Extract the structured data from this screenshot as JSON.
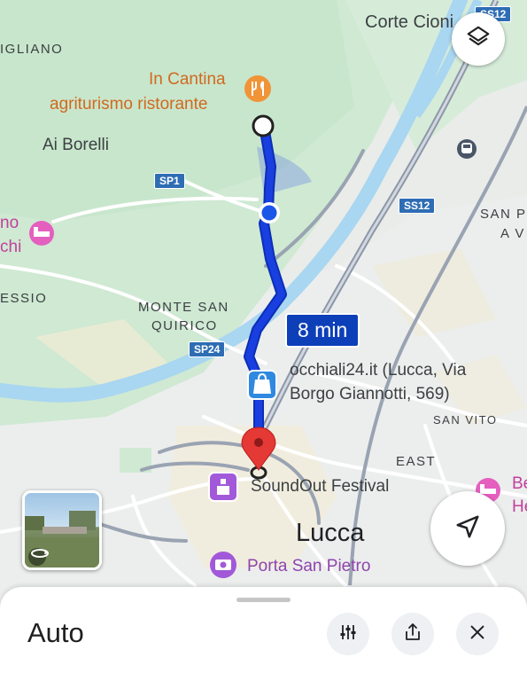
{
  "map": {
    "places": {
      "corte_cioni": "Corte Cioni",
      "migliano": "IGLIANO",
      "ai_borelli": "Ai Borelli",
      "monte_san_quirico_1": "MONTE SAN",
      "monte_san_quirico_2": "QUIRICO",
      "essio": "ESSIO",
      "san_pietro_1": "SAN P",
      "san_pietro_2": "A V",
      "san_vito": "SAN VITO",
      "east": "EAST",
      "lucca": "Lucca"
    },
    "pois": {
      "in_cantina_1": "In Cantina",
      "in_cantina_2": "agriturismo ristorante",
      "occhiali_1": "occhiali24.it (Lucca, Via",
      "occhiali_2": "Borgo Giannotti, 569)",
      "soundout": "SoundOut Festival",
      "porta_san_pietro": "Porta San Pietro",
      "hotel_left_1": "no",
      "hotel_left_2": "chi",
      "hotel_right_1": "Be",
      "hotel_right_2": "He"
    },
    "roads": {
      "sp1": "SP1",
      "sp24": "SP24",
      "ss12_top": "SS12",
      "ss12": "SS12"
    },
    "route": {
      "eta": "8 min",
      "color": "#1a3fe0"
    }
  },
  "controls": {
    "layers_icon": "layers-icon",
    "recenter_icon": "navigation-arrow-icon",
    "transit_icon": "train-icon"
  },
  "bottom_sheet": {
    "title": "Auto",
    "buttons": {
      "options": "tune-icon",
      "share": "share-icon",
      "close": "close-icon"
    }
  }
}
